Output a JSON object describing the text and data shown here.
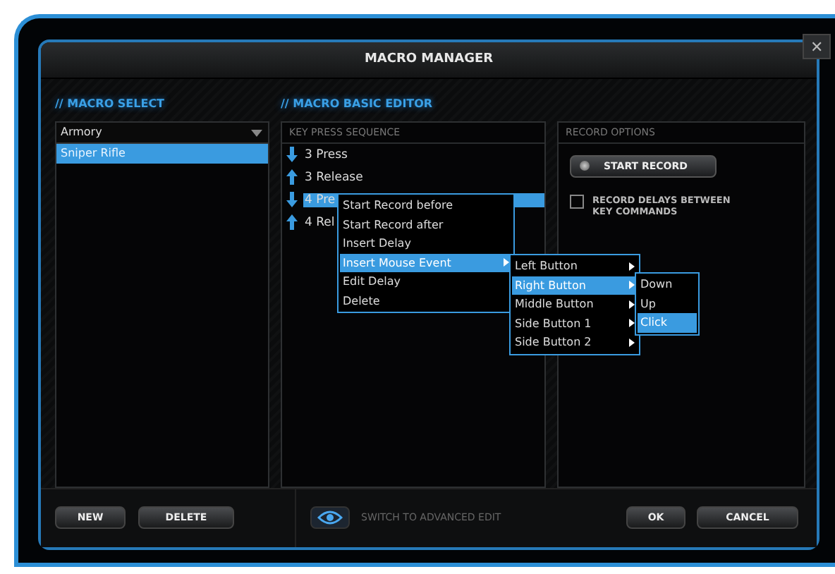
{
  "window": {
    "title": "MACRO MANAGER",
    "close": "✕"
  },
  "macro_select": {
    "heading": "// MACRO SELECT",
    "dropdown": {
      "value": "Armory"
    },
    "items": [
      {
        "label": "Sniper Rifle",
        "selected": true
      }
    ]
  },
  "basic_editor": {
    "heading": "// MACRO BASIC EDITOR",
    "sequence": {
      "heading": "KEY PRESS SEQUENCE",
      "rows": [
        {
          "kind": "down",
          "label": "3 Press",
          "selected": false
        },
        {
          "kind": "up",
          "label": "3 Release",
          "selected": false
        },
        {
          "kind": "down",
          "label": "4 Pre",
          "selected": true
        },
        {
          "kind": "up",
          "label": "4 Rel",
          "selected": false
        }
      ]
    },
    "record_options": {
      "heading": "RECORD OPTIONS",
      "button": "START RECORD",
      "checkbox": {
        "label": "RECORD DELAYS BETWEEN KEY COMMANDS",
        "checked": false
      }
    }
  },
  "context_menu": {
    "items": [
      {
        "label": "Start Record before",
        "selected": false,
        "arrow": false
      },
      {
        "label": "Start Record after",
        "selected": false,
        "arrow": false
      },
      {
        "label": "Insert Delay",
        "selected": false,
        "arrow": false
      },
      {
        "label": "Insert Mouse Event",
        "selected": true,
        "arrow": true
      },
      {
        "label": "Edit Delay",
        "selected": false,
        "arrow": false
      },
      {
        "label": "Delete",
        "selected": false,
        "arrow": false
      }
    ]
  },
  "mouse_submenu": {
    "items": [
      {
        "label": "Left Button",
        "selected": false,
        "arrow": true
      },
      {
        "label": "Right Button",
        "selected": true,
        "arrow": true
      },
      {
        "label": "Middle Button",
        "selected": false,
        "arrow": true
      },
      {
        "label": "Side Button 1",
        "selected": false,
        "arrow": true
      },
      {
        "label": "Side Button 2",
        "selected": false,
        "arrow": true
      }
    ]
  },
  "action_submenu": {
    "items": [
      {
        "label": "Down",
        "selected": false,
        "arrow": false
      },
      {
        "label": "Up",
        "selected": false,
        "arrow": false
      },
      {
        "label": "Click",
        "selected": true,
        "arrow": false
      }
    ]
  },
  "footer": {
    "left_buttons": [
      "NEW",
      "DELETE"
    ],
    "advanced_edit": "SWITCH TO ADVANCED EDIT",
    "right_buttons": [
      "OK",
      "CANCEL"
    ]
  }
}
